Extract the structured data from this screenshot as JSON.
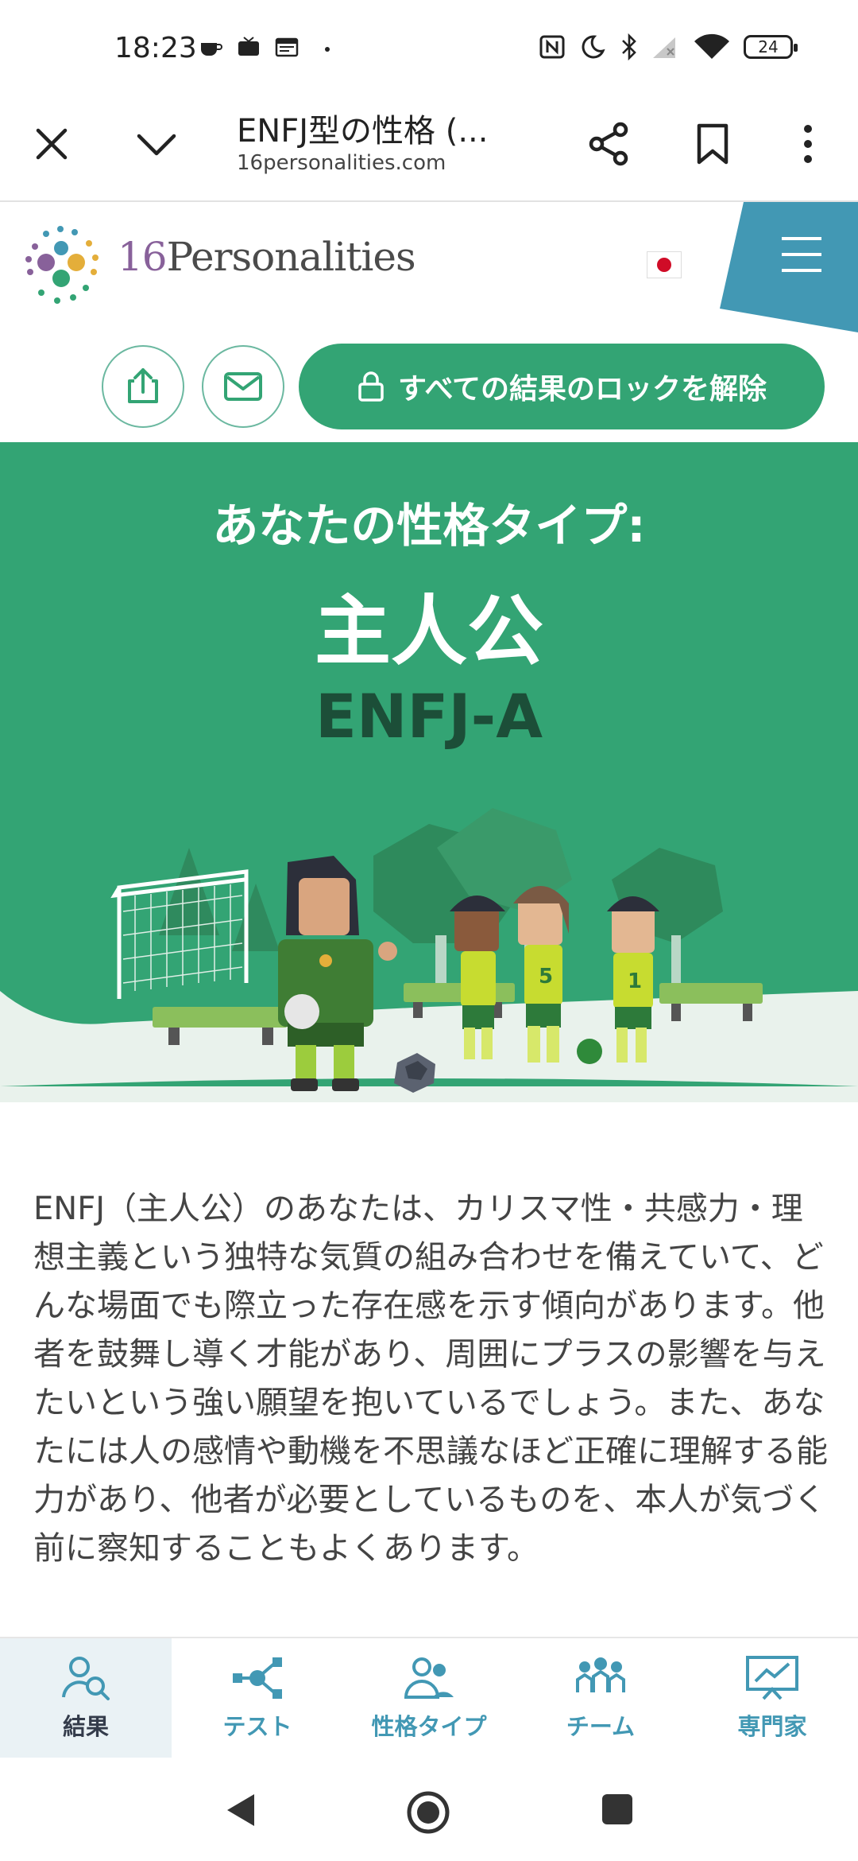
{
  "status": {
    "time": "18:23",
    "battery": "24"
  },
  "browser": {
    "title": "ENFJ型の性格 (...",
    "url": "16personalities.com"
  },
  "site": {
    "logo_num": "16",
    "logo_word": "Personalities",
    "unlock_label": "すべての結果のロックを解除"
  },
  "hero": {
    "subtitle": "あなたの性格タイプ:",
    "name": "主人公",
    "code": "ENFJ-A"
  },
  "description": "ENFJ（主人公）のあなたは、カリスマ性・共感力・理想主義という独特な気質の組み合わせを備えていて、どんな場面でも際立った存在感を示す傾向があります。他者を鼓舞し導く才能があり、周囲にプラスの影響を与えたいという強い願望を抱いているでしょう。また、あなたには人の感情や動機を不思議なほど正確に理解する能力があり、他者が必要としているものを、本人が気づく前に察知することもよくあります。",
  "tabs": [
    {
      "label": "結果",
      "icon": "results-icon"
    },
    {
      "label": "テスト",
      "icon": "test-icon"
    },
    {
      "label": "性格タイプ",
      "icon": "personality-types-icon"
    },
    {
      "label": "チーム",
      "icon": "teams-icon"
    },
    {
      "label": "専門家",
      "icon": "professionals-icon"
    }
  ],
  "colors": {
    "brand_green": "#33a474",
    "dark_green": "#1c4e38",
    "tab_blue": "#4298b4",
    "menu_blue": "#4298b4"
  }
}
